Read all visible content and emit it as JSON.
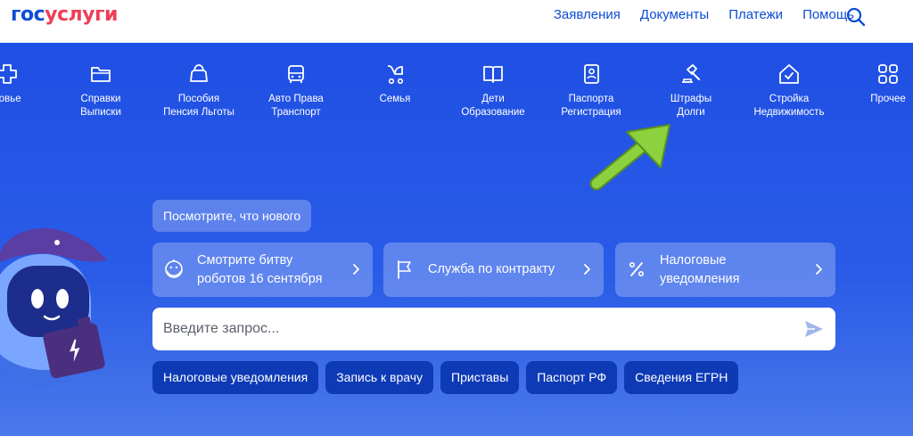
{
  "header": {
    "logo_part1": "гос",
    "logo_part2": "услуги",
    "nav": [
      "Заявления",
      "Документы",
      "Платежи",
      "Помощь"
    ],
    "search_icon": "search-icon"
  },
  "categories": [
    {
      "line1": "ровье",
      "line2": "",
      "icon": "health-icon"
    },
    {
      "line1": "Справки",
      "line2": "Выписки",
      "icon": "folder-icon"
    },
    {
      "line1": "Пособия",
      "line2": "Пенсия Льготы",
      "icon": "wallet-icon"
    },
    {
      "line1": "Авто Права",
      "line2": "Транспорт",
      "icon": "car-icon"
    },
    {
      "line1": "Семья",
      "line2": "",
      "icon": "stroller-icon"
    },
    {
      "line1": "Дети",
      "line2": "Образование",
      "icon": "book-icon"
    },
    {
      "line1": "Паспорта",
      "line2": "Регистрация",
      "icon": "passport-icon"
    },
    {
      "line1": "Штрафы",
      "line2": "Долги",
      "icon": "gavel-icon"
    },
    {
      "line1": "Стройка",
      "line2": "Недвижимость",
      "icon": "house-icon"
    },
    {
      "line1": "Прочее",
      "line2": "",
      "icon": "grid-icon"
    }
  ],
  "whats_new": "Посмотрите, что нового",
  "cards": [
    {
      "line1": "Смотрите битву",
      "line2": "роботов 16 сентября",
      "icon": "robot-face-icon"
    },
    {
      "line1": "Служба по контракту",
      "line2": "",
      "icon": "flag-icon"
    },
    {
      "line1": "Налоговые",
      "line2": "уведомления",
      "icon": "percent-icon"
    }
  ],
  "search": {
    "placeholder": "Введите запрос..."
  },
  "chips": [
    "Налоговые уведомления",
    "Запись к врачу",
    "Приставы",
    "Паспорт РФ",
    "Сведения ЕГРН"
  ],
  "colors": {
    "brand_blue": "#0d4cd3",
    "brand_red": "#ee3f58",
    "hero_blue": "#2a5ce8",
    "chip_blue": "#0e3ab6",
    "arrow_green": "#8cd23f"
  }
}
